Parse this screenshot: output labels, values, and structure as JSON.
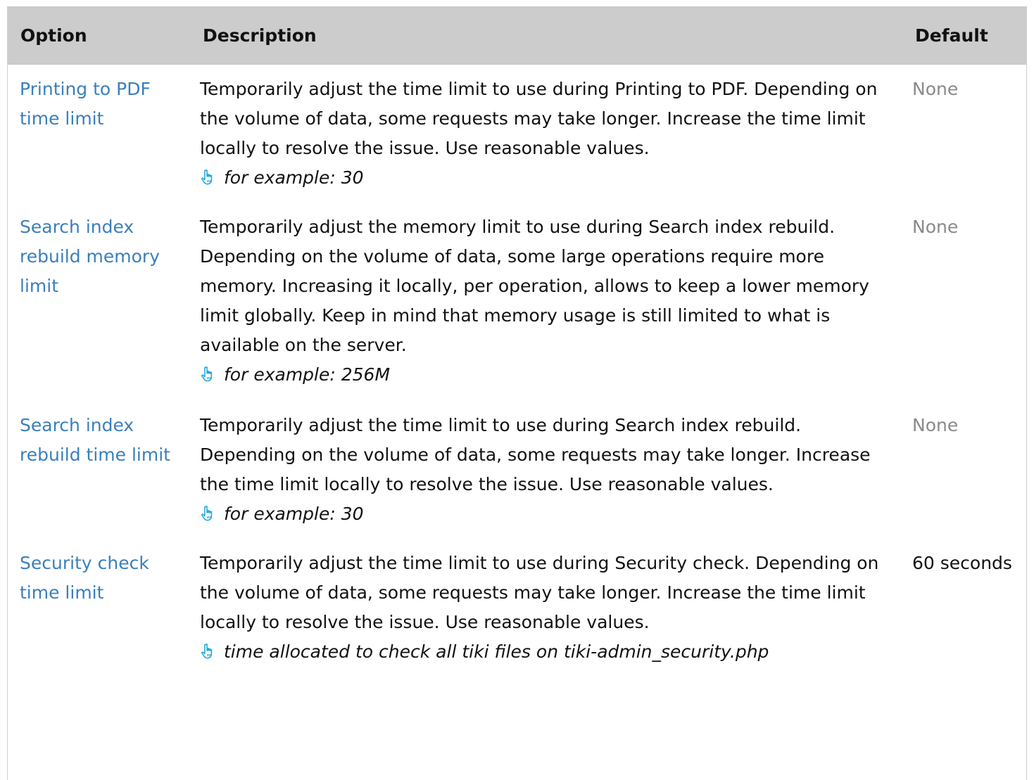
{
  "headers": {
    "option": "Option",
    "description": "Description",
    "default": "Default"
  },
  "rows": [
    {
      "option": "Printing to PDF time limit",
      "description": "Temporarily adjust the time limit to use during Printing to PDF. Depending on the volume of data, some requests may take longer. Increase the time limit locally to resolve the issue. Use reasonable values.",
      "hint": "for example: 30",
      "hint_icon": "pointing-hand-icon",
      "default": "None"
    },
    {
      "option": "Search index rebuild memory limit",
      "description": "Temporarily adjust the memory limit to use during Search index rebuild. Depending on the volume of data, some large operations require more memory. Increasing it locally, per operation, allows to keep a lower memory limit globally. Keep in mind that memory usage is still limited to what is available on the server.",
      "hint": "for example: 256M",
      "hint_icon": "pointing-hand-icon",
      "default": "None"
    },
    {
      "option": "Search index rebuild time limit",
      "description": "Temporarily adjust the time limit to use during Search index rebuild. Depending on the volume of data, some requests may take longer. Increase the time limit locally to resolve the issue. Use reasonable values.",
      "hint": "for example: 30",
      "hint_icon": "pointing-hand-icon",
      "default": "None"
    },
    {
      "option": "Security check time limit",
      "description": "Temporarily adjust the time limit to use during Security check. Depending on the volume of data, some requests may take longer. Increase the time limit locally to resolve the issue. Use reasonable values.",
      "hint": "time allocated to check all tiki files on tiki-admin_security.php",
      "hint_icon": "pointing-hand-icon",
      "default": "60 seconds"
    }
  ],
  "colors": {
    "header_bg": "#cccccc",
    "link": "#3a7fbd",
    "muted_default": "#8a8a8a",
    "hint_icon": "#29a9dc"
  }
}
